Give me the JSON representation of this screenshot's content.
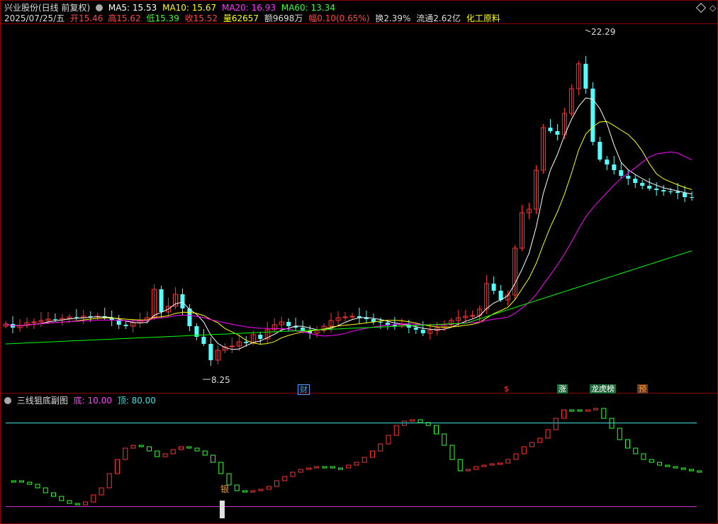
{
  "header": {
    "title": "兴业股份(日线 前复权)",
    "ma_labels": [
      {
        "text": "MA5: 15.53",
        "color": "#ffffff"
      },
      {
        "text": "MA10: 15.67",
        "color": "#ffff00"
      },
      {
        "text": "MA20: 16.93",
        "color": "#ff00ff"
      },
      {
        "text": "MA60: 13.34",
        "color": "#00ff00"
      }
    ],
    "date": "2025/07/25/五",
    "open_label": "开",
    "open_value": "15.46",
    "high_label": "高",
    "high_value": "15.62",
    "low_label": "低",
    "low_value": "15.39",
    "close_label": "收",
    "close_value": "15.52",
    "volume_label": "量",
    "volume_value": "62657",
    "amount": "额9698万",
    "change_label": "幅",
    "change_value": "0.10(0.65%)",
    "turnover": "换2.39%",
    "float": "流通2.62亿",
    "sector": "化工原料"
  },
  "main_chart": {
    "high_marker": "22.29",
    "low_marker": "8.25",
    "event_badges": [
      {
        "label": "财",
        "color": "#4fa3ff"
      },
      {
        "label": "$",
        "color": "#ff3333"
      },
      {
        "label": "涨",
        "color": "#ffffff"
      },
      {
        "label": "龙虎榜",
        "color": "#ffffff"
      },
      {
        "label": "预",
        "color": "#ff9933"
      }
    ]
  },
  "sub_chart": {
    "title": "三线狙底副图",
    "bottom_label": "底: 10.00",
    "top_label": "顶: 80.00",
    "marker": "银"
  },
  "colors": {
    "up": "#ff3232",
    "down": "#54ffff",
    "ma5": "#ffffff",
    "ma10": "#ffff00",
    "ma20": "#ff00ff",
    "ma60": "#00ff00",
    "osc_up": "#ff3232",
    "osc_down": "#32ff32",
    "top_line": "#40e0e0",
    "bottom_line": "#cc33cc"
  }
}
